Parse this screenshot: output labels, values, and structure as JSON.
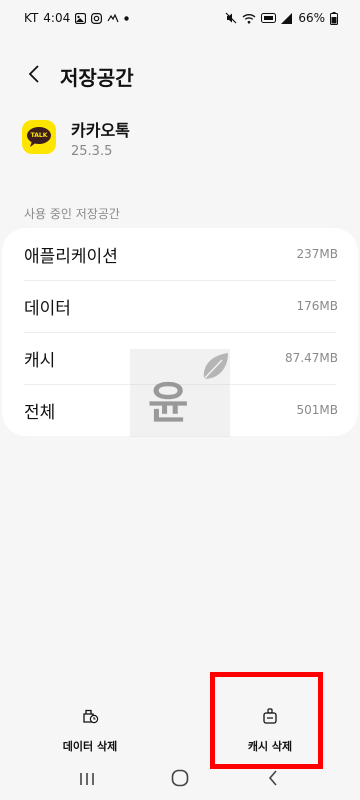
{
  "status_bar": {
    "carrier": "KT",
    "time": "4:04",
    "battery": "66%",
    "left_icons": [
      "gallery-icon",
      "instagram-icon",
      "signal-app-icon",
      "dot-icon"
    ],
    "right_icons": [
      "mute-icon",
      "wifi-icon",
      "volte-icon",
      "signal-icon",
      "battery-icon"
    ]
  },
  "header": {
    "title": "저장공간"
  },
  "app": {
    "name": "카카오톡",
    "version": "25.3.5",
    "icon_label": "TALK",
    "icon_color": "#fee500"
  },
  "storage": {
    "section_label": "사용 중인 저장공간",
    "rows": [
      {
        "label": "애플리케이션",
        "value": "237MB"
      },
      {
        "label": "데이터",
        "value": "176MB"
      },
      {
        "label": "캐시",
        "value": "87.47MB"
      },
      {
        "label": "전체",
        "value": "501MB"
      }
    ]
  },
  "watermark": {
    "text": "윤"
  },
  "actions": {
    "clear_data": "데이터 삭제",
    "clear_cache": "캐시 삭제"
  },
  "highlight_color": "#ff0000"
}
